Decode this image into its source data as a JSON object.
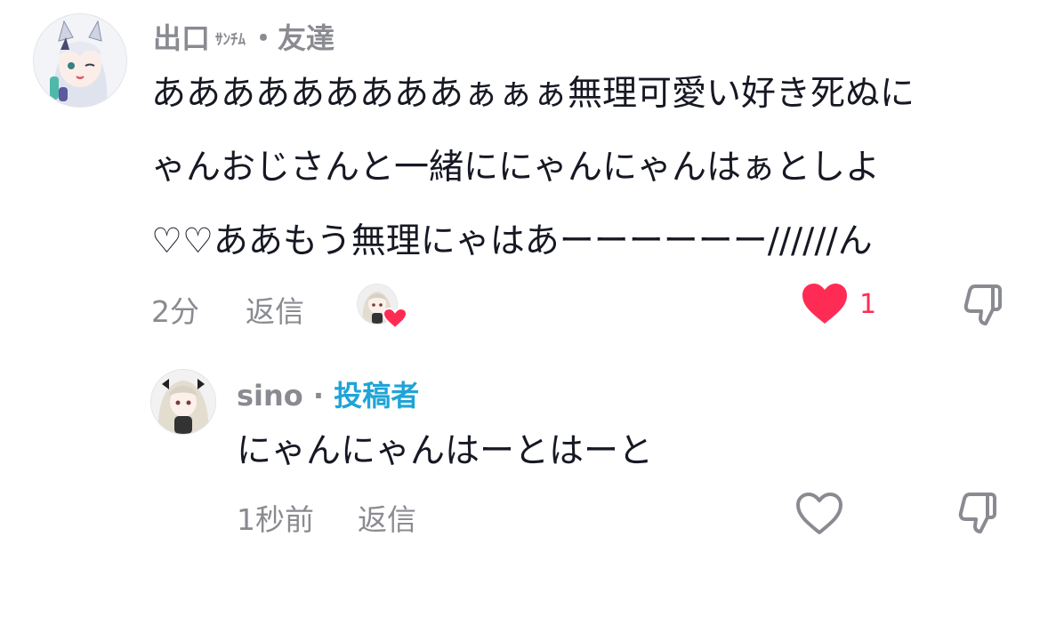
{
  "comments": [
    {
      "author": "出口",
      "author_tag": "ｻﾝﾁﾑ",
      "separator": "・",
      "relation": "友達",
      "lines": [
        "あああああああああぁぁぁ無理可愛い好き死ぬに",
        "ゃんおじさんと一緒ににゃんにゃんはぁとしよ",
        "♡♡ああもう無理にゃはあーーーーーー//////ん"
      ],
      "time": "2分",
      "reply_label": "返信",
      "likes": "1",
      "liked": true,
      "liker_avatar_icon": "liked-by-author-avatar",
      "colors": {
        "like": "#fe2c55"
      }
    },
    {
      "author": "sino",
      "separator": " · ",
      "role": "投稿者",
      "lines": [
        "にゃんにゃんはーとはーと"
      ],
      "time": "1秒前",
      "reply_label": "返信",
      "liked": false,
      "colors": {
        "creator": "#20a4d6"
      }
    }
  ]
}
